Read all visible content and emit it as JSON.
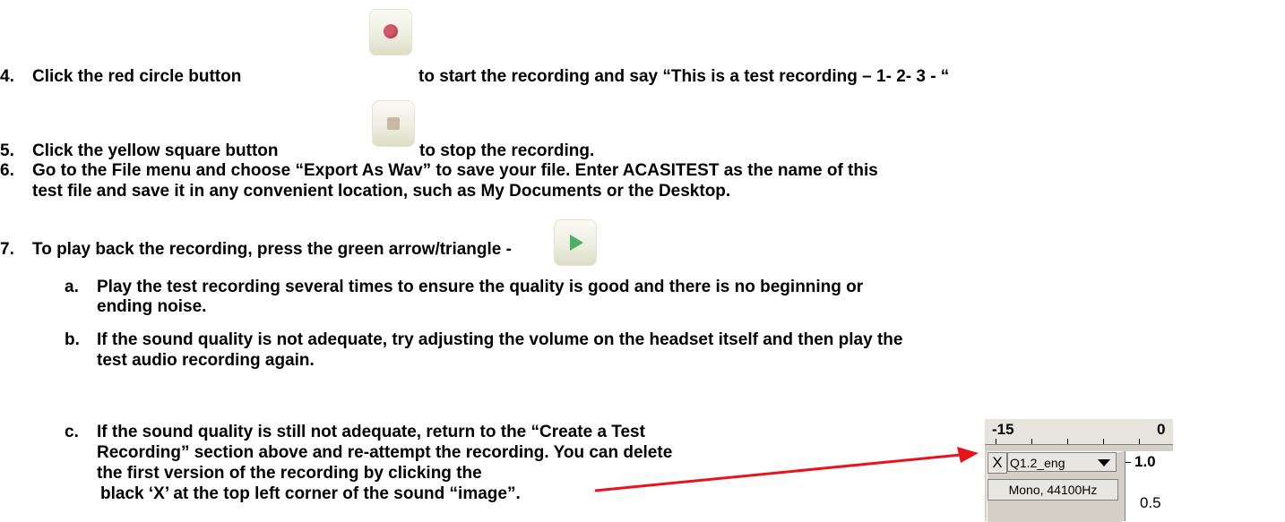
{
  "steps": {
    "s4": {
      "num": "4.",
      "text1": "Click the red circle button",
      "text2": "to start the recording and say “This is a test recording – 1- 2- 3 - “",
      "button_icon": "record-button"
    },
    "s5": {
      "num": "5.",
      "text1": "Click the yellow square button",
      "text2": "to stop the recording.",
      "button_icon": "stop-button"
    },
    "s6": {
      "num": "6.",
      "line1": "Go to the File menu and choose “Export As Wav” to save your file. Enter ACASITEST as the name of this",
      "line2": "test file and save it in any convenient location, such as My Documents or the Desktop."
    },
    "s7": {
      "num": "7.",
      "text1": "To play back the recording, press the green arrow/triangle -",
      "button_icon": "play-button"
    }
  },
  "substeps": {
    "a": {
      "label": "a.",
      "line1": "Play the test recording several times to ensure the quality is good and there is no beginning or",
      "line2": "ending noise."
    },
    "b": {
      "label": "b.",
      "line1": "If the sound quality is not adequate, try adjusting the volume on the headset itself and then play the",
      "line2": "test audio recording again."
    },
    "c": {
      "label": "c.",
      "line1": "If the sound quality is still not adequate, return to the “Create a Test",
      "line2": "Recording” section above and re-attempt the recording. You can delete",
      "line3": "the first version of the recording by clicking the",
      "line4": "black ‘X’ at the top left corner of the sound “image”."
    }
  },
  "track_panel": {
    "ruler_left": "-15",
    "ruler_right": "0",
    "close": "X",
    "track_name": "Q1.2_eng",
    "track_info": "Mono, 44100Hz",
    "scale_top": "1.0",
    "scale_mid": "0.5"
  },
  "colors": {
    "arrow": "#e8141c",
    "record": "#d35a6a",
    "play": "#4caf68",
    "stop": "#c7b9a2"
  }
}
